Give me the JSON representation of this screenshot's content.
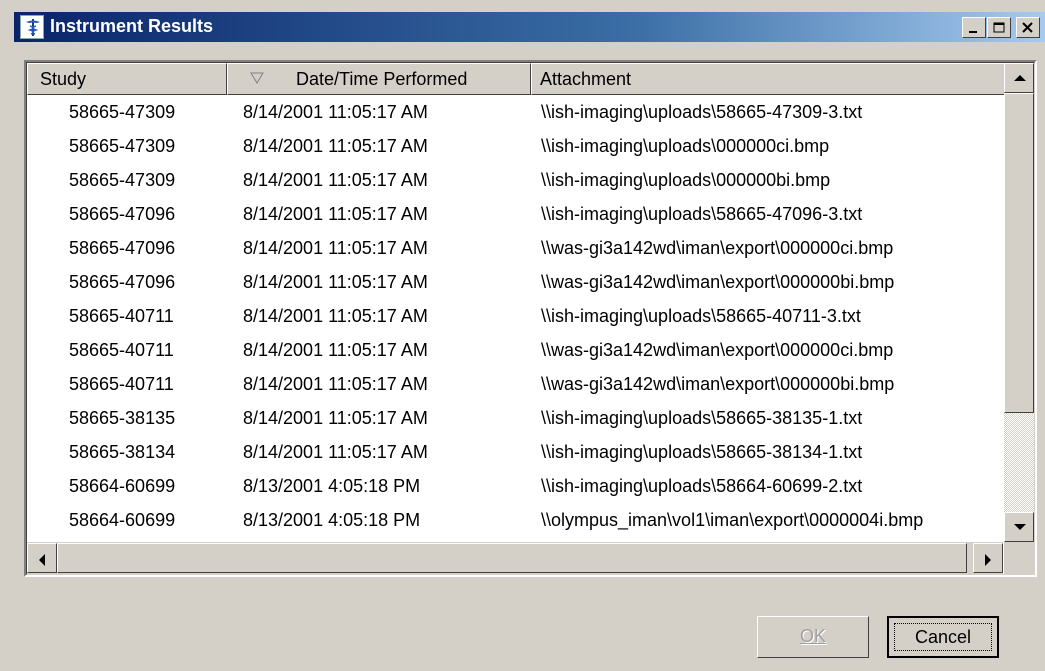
{
  "window": {
    "title": "Instrument Results",
    "controls": [
      "minimize-icon",
      "maximize-icon",
      "close-icon"
    ]
  },
  "table": {
    "columns": [
      {
        "label": "Study"
      },
      {
        "label": "Date/Time Performed",
        "sort": "descending"
      },
      {
        "label": "Attachment"
      }
    ],
    "rows": [
      {
        "study": "58665-47309",
        "date": "8/14/2001 11:05:17 AM",
        "attachment": "\\\\ish-imaging\\uploads\\58665-47309-3.txt"
      },
      {
        "study": "58665-47309",
        "date": "8/14/2001 11:05:17 AM",
        "attachment": "\\\\ish-imaging\\uploads\\000000ci.bmp"
      },
      {
        "study": "58665-47309",
        "date": "8/14/2001 11:05:17 AM",
        "attachment": "\\\\ish-imaging\\uploads\\000000bi.bmp"
      },
      {
        "study": "58665-47096",
        "date": "8/14/2001 11:05:17 AM",
        "attachment": "\\\\ish-imaging\\uploads\\58665-47096-3.txt"
      },
      {
        "study": "58665-47096",
        "date": "8/14/2001 11:05:17 AM",
        "attachment": "\\\\was-gi3a142wd\\iman\\export\\000000ci.bmp"
      },
      {
        "study": "58665-47096",
        "date": "8/14/2001 11:05:17 AM",
        "attachment": "\\\\was-gi3a142wd\\iman\\export\\000000bi.bmp"
      },
      {
        "study": "58665-40711",
        "date": "8/14/2001 11:05:17 AM",
        "attachment": "\\\\ish-imaging\\uploads\\58665-40711-3.txt"
      },
      {
        "study": "58665-40711",
        "date": "8/14/2001 11:05:17 AM",
        "attachment": "\\\\was-gi3a142wd\\iman\\export\\000000ci.bmp"
      },
      {
        "study": "58665-40711",
        "date": "8/14/2001 11:05:17 AM",
        "attachment": "\\\\was-gi3a142wd\\iman\\export\\000000bi.bmp"
      },
      {
        "study": "58665-38135",
        "date": "8/14/2001 11:05:17 AM",
        "attachment": "\\\\ish-imaging\\uploads\\58665-38135-1.txt"
      },
      {
        "study": "58665-38134",
        "date": "8/14/2001 11:05:17 AM",
        "attachment": "\\\\ish-imaging\\uploads\\58665-38134-1.txt"
      },
      {
        "study": "58664-60699",
        "date": "8/13/2001 4:05:18 PM",
        "attachment": "\\\\ish-imaging\\uploads\\58664-60699-2.txt"
      },
      {
        "study": "58664-60699",
        "date": "8/13/2001 4:05:18 PM",
        "attachment": "\\\\olympus_iman\\vol1\\iman\\export\\0000004i.bmp"
      }
    ]
  },
  "buttons": {
    "ok": {
      "label": "OK",
      "enabled": false
    },
    "cancel": {
      "label": "Cancel",
      "enabled": true
    }
  },
  "colors": {
    "titlebar_start": "#0a246a",
    "titlebar_end": "#a6caf0",
    "face": "#d4d0c8"
  }
}
